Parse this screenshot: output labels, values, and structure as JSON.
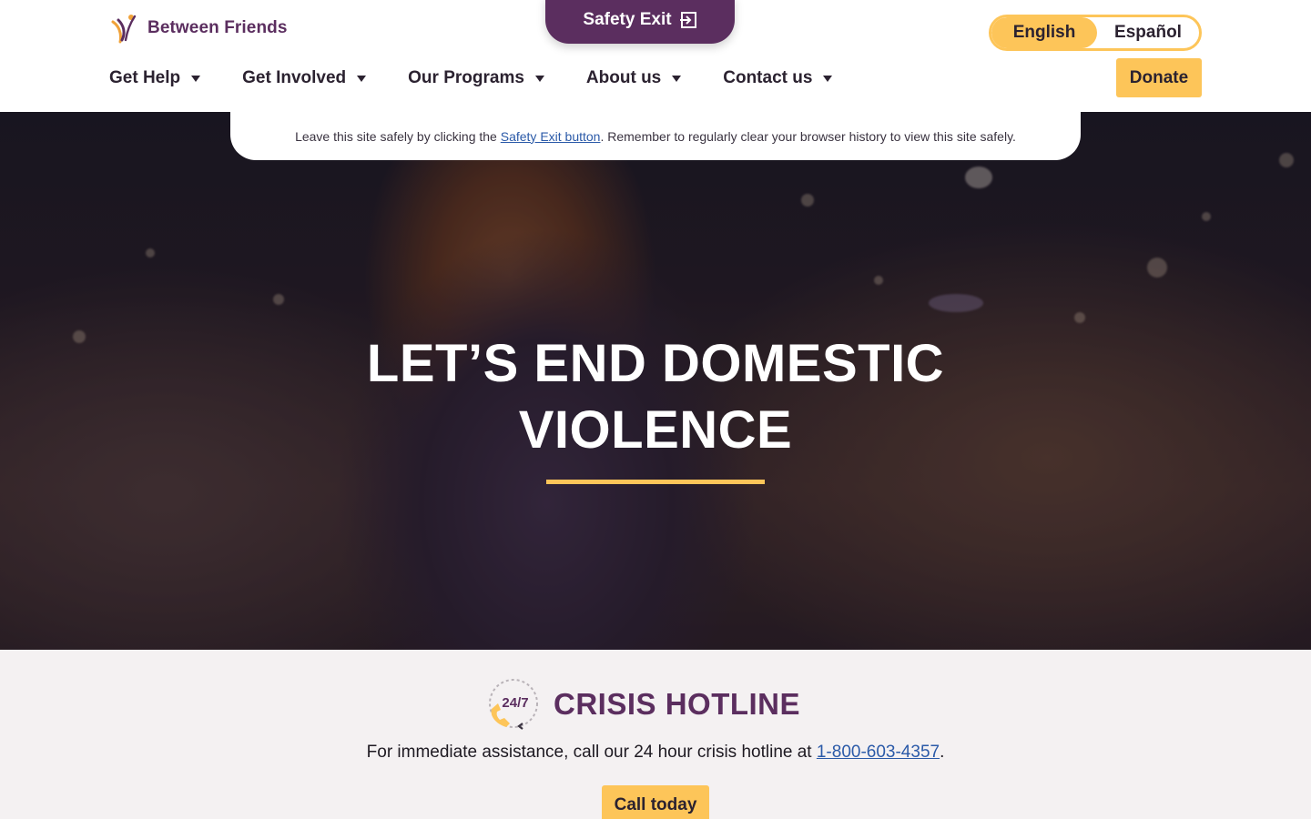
{
  "header": {
    "logo_text": "Between Friends",
    "safety_exit_label": "Safety Exit",
    "languages": [
      {
        "label": "English",
        "active": true
      },
      {
        "label": "Español",
        "active": false
      }
    ],
    "nav": [
      {
        "label": "Get Help"
      },
      {
        "label": "Get Involved"
      },
      {
        "label": "Our Programs"
      },
      {
        "label": "About us"
      },
      {
        "label": "Contact us"
      }
    ],
    "donate_label": "Donate"
  },
  "safety_banner": {
    "text_before": "Leave this site safely by clicking the ",
    "link_text": "Safety Exit button",
    "text_after": ". Remember to regularly clear your browser history to view this site safely."
  },
  "hero": {
    "title_line1": "LET’S END DOMESTIC",
    "title_line2": "VIOLENCE"
  },
  "crisis": {
    "icon_label": "24/7",
    "title": "CRISIS HOTLINE",
    "text_before": "For immediate assistance, call our 24 hour crisis hotline at ",
    "phone": "1-800-603-4357",
    "text_after": ".",
    "button_label": "Call today"
  },
  "colors": {
    "brand_purple": "#5b2e5f",
    "accent_yellow": "#fdc559",
    "link_blue": "#2b5aa8"
  }
}
